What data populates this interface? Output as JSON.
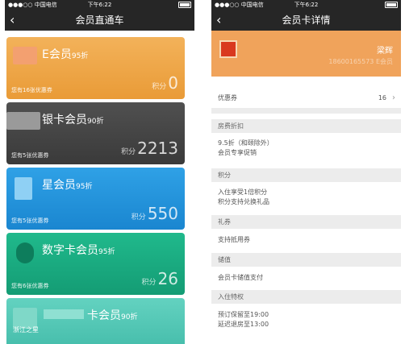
{
  "status": {
    "carrier": "●●●○○ 中国电信",
    "time": "下午6:22"
  },
  "left": {
    "title": "会员直通车",
    "cards": [
      {
        "name": "E会员",
        "discount": "95折",
        "coupons": "您有16张优惠券",
        "points_label": "积分",
        "points": "0",
        "color": "#ed9f3c"
      },
      {
        "name": "银卡会员",
        "discount": "90折",
        "coupons": "您有5张优惠券",
        "points_label": "积分",
        "points": "2213",
        "color": "#454545"
      },
      {
        "name": "星会员",
        "discount": "95折",
        "coupons": "您有5张优惠券",
        "points_label": "积分",
        "points": "550",
        "color": "#1f8fd8"
      },
      {
        "name": "数字卡会员",
        "discount": "95折",
        "coupons": "您有6张优惠券",
        "points_label": "积分",
        "points": "26",
        "color": "#18a87e"
      },
      {
        "name": "卡会员",
        "discount": "90折",
        "brand": "浙江之星"
      }
    ]
  },
  "right": {
    "title": "会员卡详情",
    "user_name": "梁辉",
    "user_id": "18600165573 E会员",
    "coupon_label": "优惠券",
    "coupon_count": "16",
    "sections": [
      {
        "title": "房费折扣",
        "lines": [
          "9.5折（和颐除外）",
          "会员专享促销"
        ]
      },
      {
        "title": "积分",
        "lines": [
          "入住享受1倍积分",
          "积分支持兑换礼品"
        ]
      },
      {
        "title": "礼券",
        "lines": [
          "支持抵用券"
        ]
      },
      {
        "title": "储值",
        "lines": [
          "会员卡储值支付"
        ]
      },
      {
        "title": "入住特权",
        "lines": [
          "预订保留至19:00",
          "延迟退房至13:00"
        ]
      }
    ]
  }
}
